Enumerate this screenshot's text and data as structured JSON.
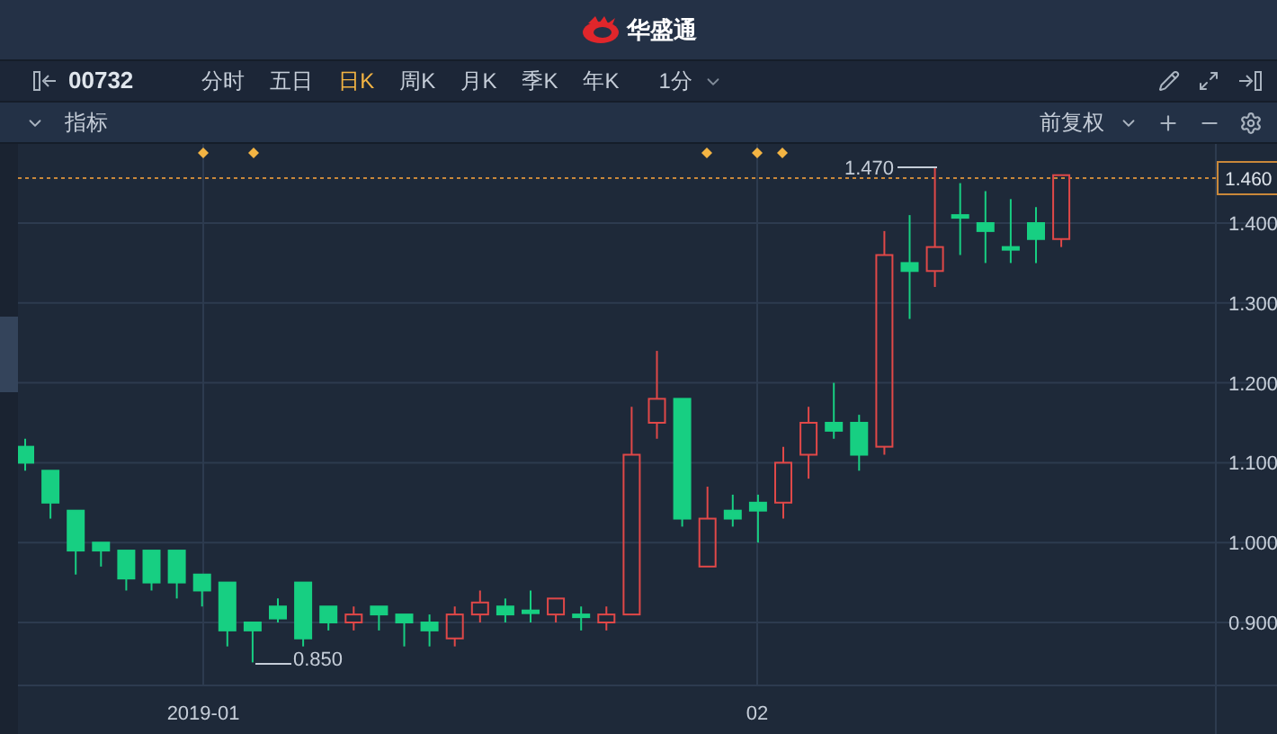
{
  "header": {
    "brand": "华盛通"
  },
  "toolbar": {
    "code": "00732",
    "periods": [
      {
        "label": "分时",
        "selected": false
      },
      {
        "label": "五日",
        "selected": false
      },
      {
        "label": "日K",
        "selected": true
      },
      {
        "label": "周K",
        "selected": false
      },
      {
        "label": "月K",
        "selected": false
      },
      {
        "label": "季K",
        "selected": false
      },
      {
        "label": "年K",
        "selected": false
      }
    ],
    "interval": "1分"
  },
  "indicator_bar": {
    "title": "指标",
    "adjust": "前复权"
  },
  "chart": {
    "price_ticks": [
      "1.400",
      "1.300",
      "1.200",
      "1.100",
      "1.000",
      "0.900"
    ],
    "current_price": "1.460",
    "high_label": "1.470",
    "low_label": "0.850",
    "date_labels": [
      "2019-01",
      "02"
    ]
  }
}
